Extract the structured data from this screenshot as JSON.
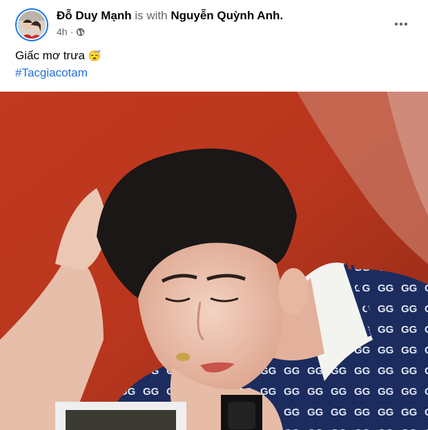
{
  "post": {
    "author_name": "Đỗ Duy Mạnh",
    "with_text": "is with",
    "tagged_name": "Nguyễn Quỳnh Anh.",
    "time": "4h",
    "dot": "·",
    "privacy_icon": "globe-icon",
    "more_icon": "more-options-icon",
    "caption": "Giấc mơ trưa",
    "caption_emoji": "😴",
    "hashtag": "#Tacgiacotam",
    "photo_icon": "painting-image"
  },
  "colors": {
    "link_blue": "#216fdb",
    "secondary_text": "#65676b",
    "avatar_ring": "#1877f2"
  }
}
